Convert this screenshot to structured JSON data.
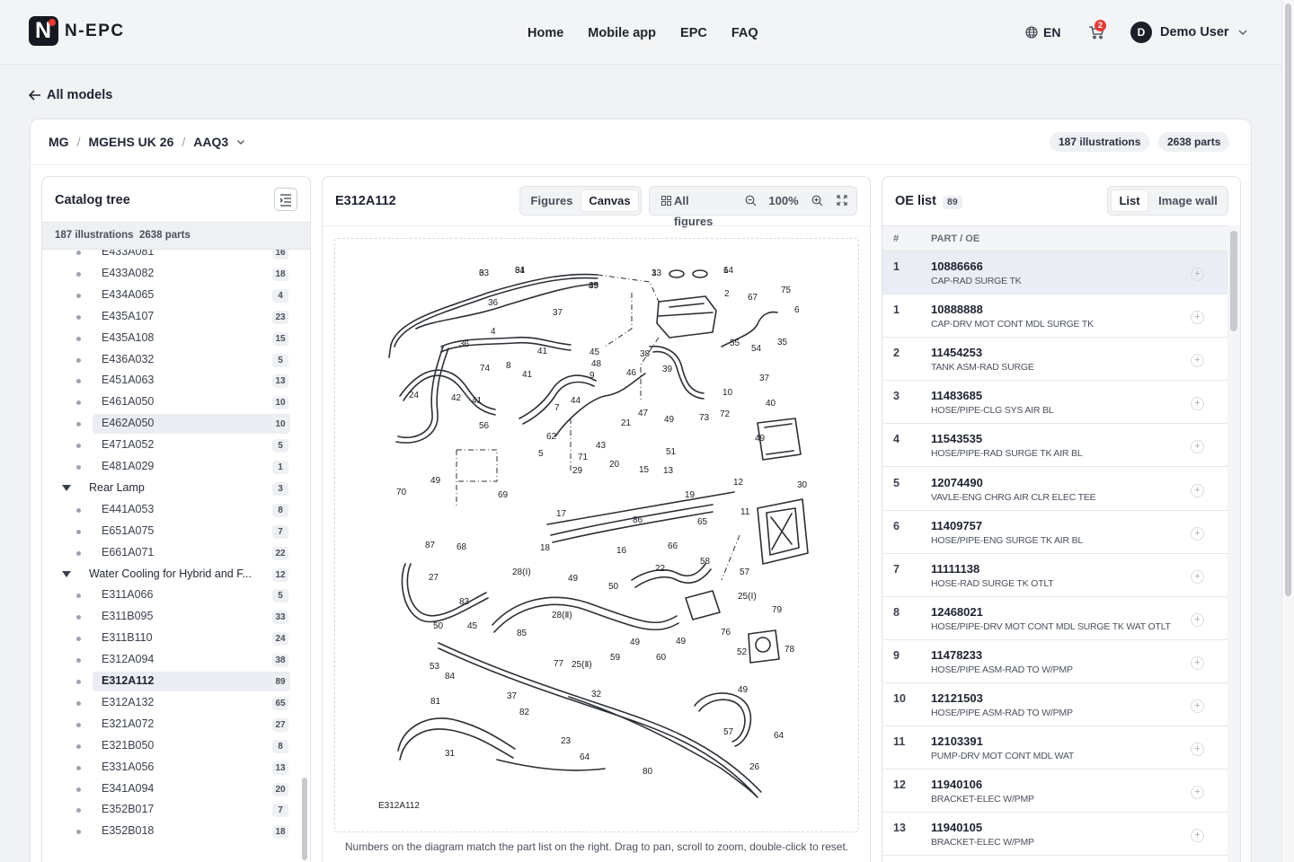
{
  "brand": {
    "name": "N-EPC",
    "logo_letter": "N"
  },
  "nav": [
    "Home",
    "Mobile app",
    "EPC",
    "FAQ"
  ],
  "lang": "EN",
  "cart_count": "2",
  "user": {
    "initial": "D",
    "name": "Demo User"
  },
  "back_link": "All models",
  "breadcrumb": [
    "MG",
    "MGEHS UK 26",
    "AAQ3"
  ],
  "stats": {
    "illustrations": "187 illustrations",
    "parts": "2638 parts"
  },
  "catalog": {
    "title": "Catalog tree",
    "summary_illustrations": "187 illustrations",
    "summary_parts": "2638 parts",
    "rows": [
      {
        "label": "E433A081",
        "count": "16"
      },
      {
        "label": "E433A082",
        "count": "18"
      },
      {
        "label": "E434A065",
        "count": "4"
      },
      {
        "label": "E435A107",
        "count": "23"
      },
      {
        "label": "E435A108",
        "count": "15"
      },
      {
        "label": "E436A032",
        "count": "5"
      },
      {
        "label": "E451A063",
        "count": "13"
      },
      {
        "label": "E461A050",
        "count": "10"
      },
      {
        "label": "E462A050",
        "count": "10"
      },
      {
        "label": "E471A052",
        "count": "5"
      },
      {
        "label": "E481A029",
        "count": "1"
      },
      {
        "label": "Rear Lamp",
        "count": "3"
      },
      {
        "label": "E441A053",
        "count": "8"
      },
      {
        "label": "E651A075",
        "count": "7"
      },
      {
        "label": "E661A071",
        "count": "22"
      },
      {
        "label": "Water Cooling for Hybrid and F...",
        "count": "12"
      },
      {
        "label": "E311A066",
        "count": "5"
      },
      {
        "label": "E311B095",
        "count": "33"
      },
      {
        "label": "E311B110",
        "count": "24"
      },
      {
        "label": "E312A094",
        "count": "38"
      },
      {
        "label": "E312A112",
        "count": "89"
      },
      {
        "label": "E312A132",
        "count": "65"
      },
      {
        "label": "E321A072",
        "count": "27"
      },
      {
        "label": "E321B050",
        "count": "8"
      },
      {
        "label": "E331A056",
        "count": "13"
      },
      {
        "label": "E341A094",
        "count": "20"
      },
      {
        "label": "E352B017",
        "count": "7"
      },
      {
        "label": "E352B018",
        "count": "18"
      }
    ]
  },
  "viewer": {
    "title": "E312A112",
    "view_tabs": [
      "Figures",
      "Canvas"
    ],
    "active_tab": "Canvas",
    "all_figures": "All figures",
    "zoom": "100%",
    "diagram_caption": "E312A112",
    "hint": "Numbers on the diagram match the part list on the right. Drag to pan, scroll to zoom, double-click to reset.",
    "callouts": [
      "3",
      "34",
      "1",
      "1",
      "35",
      "2",
      "67",
      "75",
      "36",
      "37",
      "6",
      "4",
      "36",
      "41",
      "45",
      "38",
      "55",
      "54",
      "35",
      "74",
      "8",
      "41",
      "48",
      "9",
      "46",
      "39",
      "37",
      "24",
      "42",
      "41",
      "44",
      "47",
      "10",
      "40",
      "7",
      "56",
      "62",
      "43",
      "21",
      "49",
      "73",
      "72",
      "49",
      "5",
      "71",
      "51",
      "49",
      "29",
      "20",
      "15",
      "13",
      "12",
      "30",
      "70",
      "69",
      "19",
      "17",
      "86",
      "11",
      "87",
      "68",
      "18",
      "16",
      "66",
      "65",
      "27",
      "28(Ⅰ)",
      "49",
      "50",
      "22",
      "58",
      "57",
      "25(Ⅰ)",
      "83",
      "28(Ⅱ)",
      "79",
      "50",
      "45",
      "85",
      "76",
      "49",
      "49",
      "52",
      "78",
      "53",
      "84",
      "77",
      "25(Ⅱ)",
      "59",
      "60",
      "49",
      "37",
      "32",
      "81",
      "82",
      "57",
      "64",
      "31",
      "23",
      "64",
      "80",
      "26",
      "63",
      "61",
      "33",
      "64",
      "49"
    ]
  },
  "oe_list": {
    "title": "OE list",
    "count": "89",
    "view_tabs": [
      "List",
      "Image wall"
    ],
    "active_tab": "List",
    "col_num": "#",
    "col_part": "PART / OE",
    "rows": [
      {
        "num": "1",
        "part": "10886666",
        "desc": "CAP-RAD SURGE TK"
      },
      {
        "num": "1",
        "part": "10888888",
        "desc": "CAP-DRV MOT CONT MDL SURGE TK"
      },
      {
        "num": "2",
        "part": "11454253",
        "desc": "TANK ASM-RAD SURGE"
      },
      {
        "num": "3",
        "part": "11483685",
        "desc": "HOSE/PIPE-CLG SYS AIR BL"
      },
      {
        "num": "4",
        "part": "11543535",
        "desc": "HOSE/PIPE-RAD SURGE TK AIR BL"
      },
      {
        "num": "5",
        "part": "12074490",
        "desc": "VAVLE-ENG CHRG AIR CLR ELEC TEE"
      },
      {
        "num": "6",
        "part": "11409757",
        "desc": "HOSE/PIPE-ENG SURGE TK AIR BL"
      },
      {
        "num": "7",
        "part": "11111138",
        "desc": "HOSE-RAD SURGE TK OTLT"
      },
      {
        "num": "8",
        "part": "12468021",
        "desc": "HOSE/PIPE-DRV MOT CONT MDL SURGE TK WAT OTLT"
      },
      {
        "num": "9",
        "part": "11478233",
        "desc": "HOSE/PIPE ASM-RAD TO W/PMP"
      },
      {
        "num": "10",
        "part": "12121503",
        "desc": "HOSE/PIPE ASM-RAD TO W/PMP"
      },
      {
        "num": "11",
        "part": "12103391",
        "desc": "PUMP-DRV MOT CONT MDL WAT"
      },
      {
        "num": "12",
        "part": "11940106",
        "desc": "BRACKET-ELEC W/PMP"
      },
      {
        "num": "13",
        "part": "11940105",
        "desc": "BRACKET-ELEC W/PMP"
      }
    ]
  }
}
